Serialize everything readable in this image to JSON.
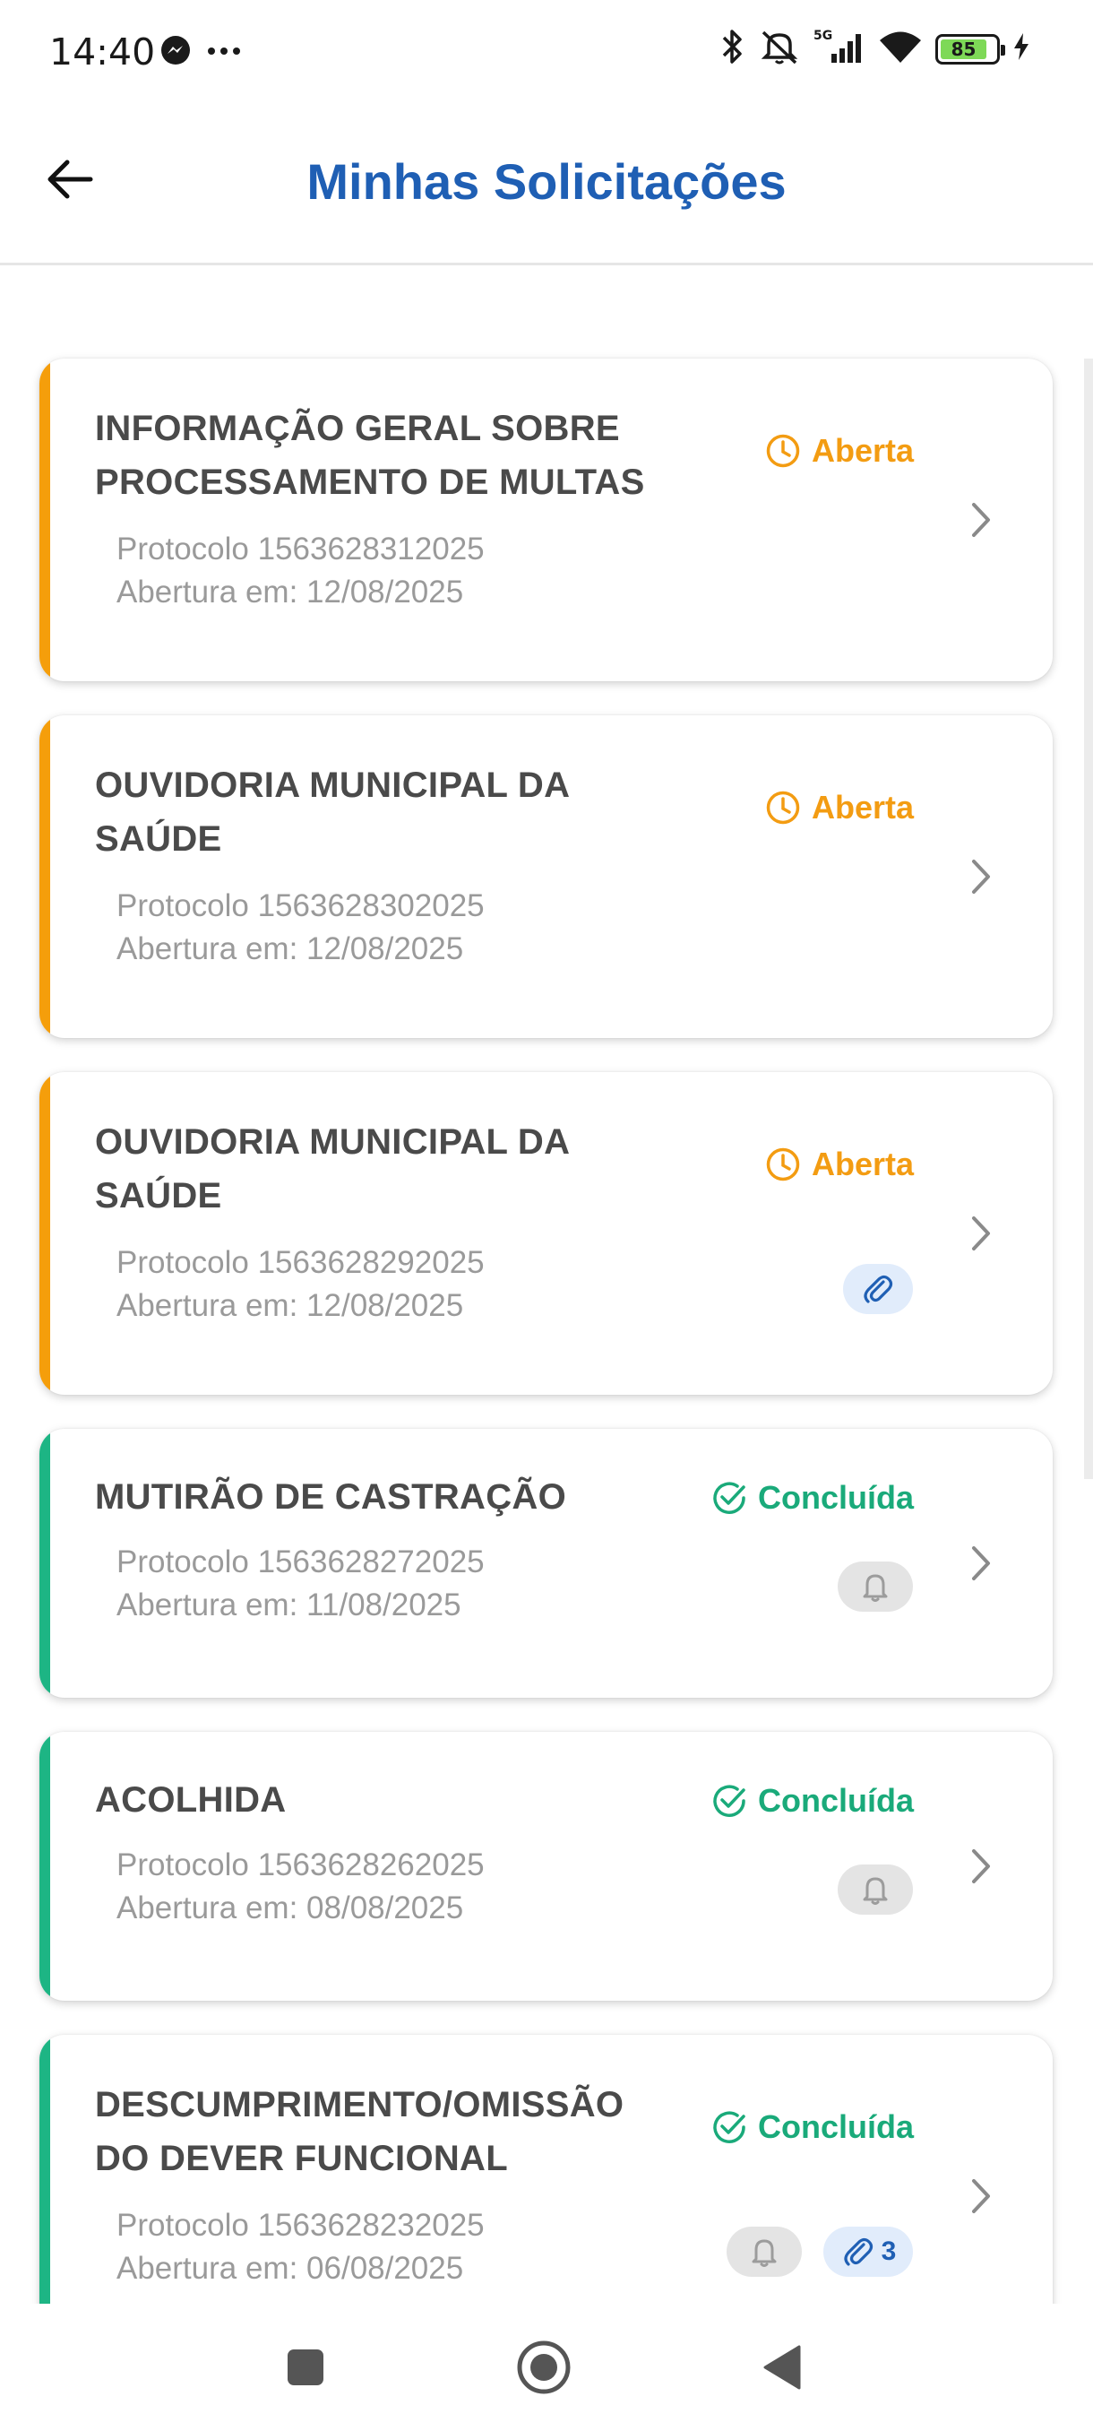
{
  "status_bar": {
    "time": "14:40",
    "battery": "85"
  },
  "header": {
    "title": "Minhas Solicitações"
  },
  "colors": {
    "title_blue": "#1f5fb4",
    "open_orange": "#f39c12",
    "done_green": "#1aaa7a"
  },
  "requests": [
    {
      "title": "INFORMAÇÃO GERAL SOBRE PROCESSAMENTO DE MULTAS",
      "status": "Aberta",
      "protocol": "Protocolo 1563628312025",
      "date": "Abertura em: 12/08/2025"
    },
    {
      "title": "OUVIDORIA MUNICIPAL DA SAÚDE",
      "status": "Aberta",
      "protocol": "Protocolo 1563628302025",
      "date": "Abertura em: 12/08/2025"
    },
    {
      "title": "OUVIDORIA MUNICIPAL DA SAÚDE",
      "status": "Aberta",
      "protocol": "Protocolo 1563628292025",
      "date": "Abertura em: 12/08/2025",
      "attachments": true
    },
    {
      "title": "MUTIRÃO DE CASTRAÇÃO",
      "status": "Concluída",
      "protocol": "Protocolo 1563628272025",
      "date": "Abertura em: 11/08/2025",
      "notifications": true
    },
    {
      "title": "ACOLHIDA",
      "status": "Concluída",
      "protocol": "Protocolo 1563628262025",
      "date": "Abertura em: 08/08/2025",
      "notifications": true
    },
    {
      "title": "DESCUMPRIMENTO/OMISSÃO DO DEVER FUNCIONAL",
      "status": "Concluída",
      "protocol": "Protocolo 1563628232025",
      "date": "Abertura em: 06/08/2025",
      "notifications": true,
      "attachment_count": "3"
    }
  ]
}
